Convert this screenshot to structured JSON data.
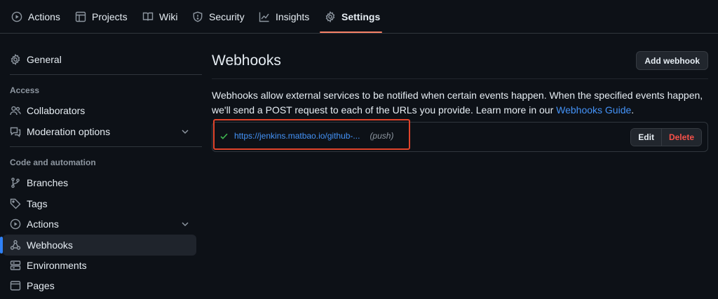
{
  "topnav": {
    "tabs": [
      {
        "label": "Actions",
        "icon": "play-icon"
      },
      {
        "label": "Projects",
        "icon": "table-icon"
      },
      {
        "label": "Wiki",
        "icon": "book-icon"
      },
      {
        "label": "Security",
        "icon": "shield-icon"
      },
      {
        "label": "Insights",
        "icon": "graph-icon"
      },
      {
        "label": "Settings",
        "icon": "gear-icon",
        "active": true
      }
    ],
    "accent_color": "#f78166"
  },
  "sidebar": {
    "general": "General",
    "access_heading": "Access",
    "access_items": [
      {
        "label": "Collaborators",
        "icon": "people-icon"
      },
      {
        "label": "Moderation options",
        "icon": "comment-icon",
        "expandable": true
      }
    ],
    "code_heading": "Code and automation",
    "code_items": [
      {
        "label": "Branches",
        "icon": "branch-icon"
      },
      {
        "label": "Tags",
        "icon": "tag-icon"
      },
      {
        "label": "Actions",
        "icon": "play-icon",
        "expandable": true
      },
      {
        "label": "Webhooks",
        "icon": "webhook-icon",
        "selected": true
      },
      {
        "label": "Environments",
        "icon": "server-icon"
      },
      {
        "label": "Pages",
        "icon": "browser-icon"
      }
    ]
  },
  "main": {
    "title": "Webhooks",
    "add_button": "Add webhook",
    "description_text": "Webhooks allow external services to be notified when certain events happen. When the specified events happen, we'll send a POST request to each of the URLs you provide. Learn more in our ",
    "description_link": "Webhooks Guide",
    "description_end": ".",
    "webhooks": [
      {
        "url": "https://jenkins.matbao.io/github-...",
        "event": "(push)",
        "status": "success",
        "edit_label": "Edit",
        "delete_label": "Delete"
      }
    ]
  },
  "colors": {
    "background": "#0d1117",
    "link": "#4493f8",
    "success": "#3fb950",
    "danger": "#f85149",
    "highlight": "#e0442b"
  }
}
